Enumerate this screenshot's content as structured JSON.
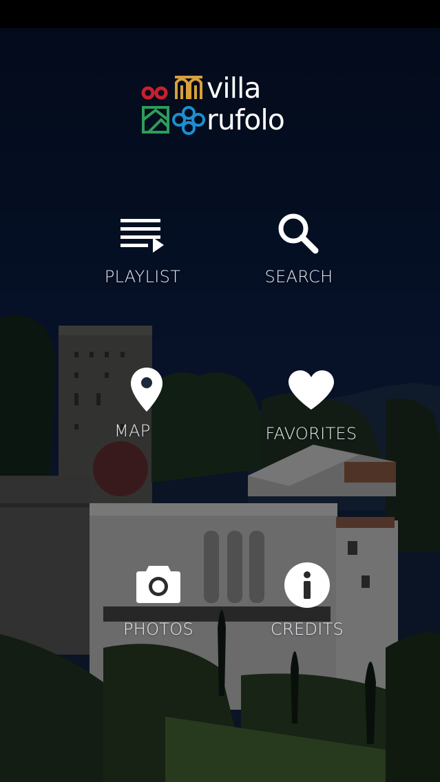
{
  "logo": {
    "line1": "villa",
    "line2": "rufolo",
    "colors": {
      "red": "#c8202e",
      "gold": "#d7a23c",
      "green": "#2e9d5a",
      "blue": "#1c8fd0"
    }
  },
  "menu": {
    "playlist": {
      "label": "PLAYLIST",
      "icon": "playlist-icon"
    },
    "search": {
      "label": "SEARCH",
      "icon": "search-icon"
    },
    "map": {
      "label": "MAP",
      "icon": "map-pin-icon"
    },
    "favorites": {
      "label": "FAVORITES",
      "icon": "heart-icon"
    },
    "photos": {
      "label": "PHOTOS",
      "icon": "camera-icon"
    },
    "credits": {
      "label": "CREDITS",
      "icon": "info-icon"
    }
  },
  "theme": {
    "sky": "#0a1a3c",
    "text": "#e9ecf2"
  }
}
